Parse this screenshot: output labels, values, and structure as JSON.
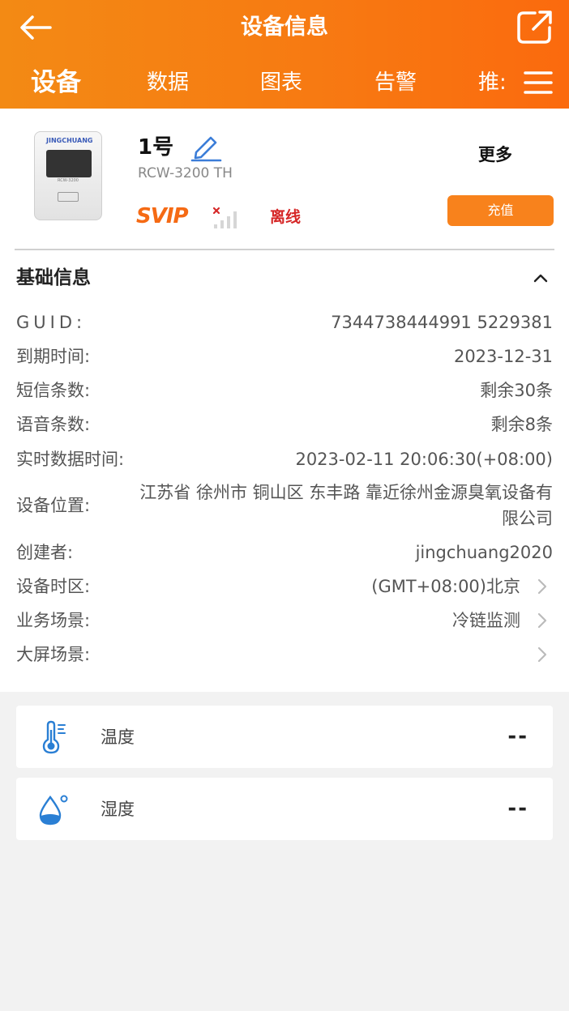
{
  "header": {
    "title": "设备信息",
    "tabs": [
      "设备",
      "数据",
      "图表",
      "告警",
      "推:"
    ],
    "back_icon": "arrow-left-icon",
    "share_icon": "share-icon",
    "menu_icon": "hamburger-menu-icon"
  },
  "device": {
    "name": "1号",
    "model": "RCW-3200 TH",
    "badge": "SVIP",
    "status": "离线",
    "more_label": "更多",
    "recharge_label": "充值",
    "image_brand": "JINGCHUANG",
    "image_screen_text": "RCW-3200"
  },
  "basic_info": {
    "title": "基础信息",
    "rows": [
      {
        "label": "GUID:",
        "value": "7344738444991 5229381"
      },
      {
        "label": "到期时间:",
        "value": "2023-12-31"
      },
      {
        "label": "短信条数:",
        "value": "剩余30条"
      },
      {
        "label": "语音条数:",
        "value": "剩余8条"
      },
      {
        "label": "实时数据时间:",
        "value": "2023-02-11 20:06:30(+08:00)"
      },
      {
        "label": "设备位置:",
        "value": "江苏省 徐州市 铜山区 东丰路 靠近徐州金源臭氧设备有限公司"
      },
      {
        "label": "创建者:",
        "value": "jingchuang2020"
      },
      {
        "label": "设备时区:",
        "value": "(GMT+08:00)北京"
      },
      {
        "label": "业务场景:",
        "value": "冷链监测"
      },
      {
        "label": "大屏场景:",
        "value": ""
      }
    ]
  },
  "sensors": [
    {
      "label": "温度",
      "value": "--",
      "icon": "thermometer-icon"
    },
    {
      "label": "湿度",
      "value": "--",
      "icon": "water-drop-icon"
    }
  ],
  "colors": {
    "header_start": "#f38a14",
    "header_end": "#fb6a0e",
    "accent": "#f8821c",
    "offline": "#d62828",
    "sensor_icon": "#2a7fd4"
  }
}
